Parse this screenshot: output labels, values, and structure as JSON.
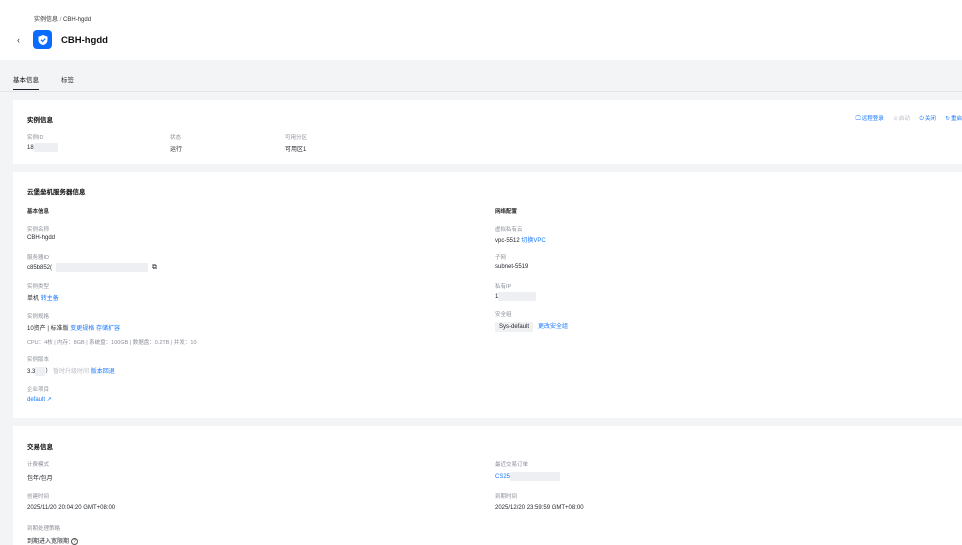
{
  "breadcrumb": {
    "parent": "实例信息",
    "separator": "/",
    "current": "CBH-hgdd"
  },
  "header": {
    "back_icon": "chevron-left-icon",
    "logo_icon": "shield-icon",
    "title": "CBH-hgdd"
  },
  "tabs": [
    {
      "label": "基本信息",
      "active": true
    },
    {
      "label": "标签",
      "active": false
    }
  ],
  "instance_card": {
    "title": "实例信息",
    "actions": [
      {
        "icon": "monitor-icon",
        "label": "远程登录",
        "enabled": true
      },
      {
        "icon": "play-icon",
        "label": "启动",
        "enabled": false
      },
      {
        "icon": "power-icon",
        "label": "关闭",
        "enabled": true
      },
      {
        "icon": "restart-icon",
        "label": "重启",
        "enabled": true
      }
    ],
    "fields": [
      {
        "label": "实例ID",
        "value": "18"
      },
      {
        "label": "状态",
        "value": "运行"
      },
      {
        "label": "可用分区",
        "value": "可用区1"
      }
    ]
  },
  "server_card": {
    "title": "云堡垒机服务器信息",
    "basic": {
      "title": "基本信息",
      "name": {
        "label": "实例名称",
        "value": "CBH-hgdd"
      },
      "server_id": {
        "label": "服务器ID",
        "value": "c85b852("
      },
      "type": {
        "label": "实例类型",
        "value": "单机",
        "link": "转主备"
      },
      "spec": {
        "label": "实例规格",
        "value": "10资产 | 标准版",
        "links": [
          "变更规格",
          "存储扩容"
        ],
        "detail": "CPU：4核 | 内存：8GB | 系统盘：100GB | 数据盘：0.2TB | 并发：10"
      },
      "version": {
        "label": "实例版本",
        "value_prefix": "3.3",
        "value_suffix": "）",
        "hint": "暂时升级时间",
        "link": "版本回退"
      },
      "project": {
        "label": "企业项目",
        "value": "default"
      }
    },
    "network": {
      "title": "网络配置",
      "vpc": {
        "label": "虚拟私有云",
        "value": "vpc-5512",
        "link": "切换VPC"
      },
      "subnet": {
        "label": "子网",
        "value": "subnet-5519"
      },
      "private_ip": {
        "label": "私有IP",
        "value": "1"
      },
      "security_group": {
        "label": "安全组",
        "value": "Sys-default",
        "link": "更改安全组"
      }
    }
  },
  "trade_card": {
    "title": "交易信息",
    "billing": {
      "label": "计费模式",
      "value": "包年/包月"
    },
    "created": {
      "label": "创建时间",
      "value": "2025/11/20 20:04:20 GMT+08:00"
    },
    "expiry_policy": {
      "label": "到期处理策略",
      "value": "到期进入宽限期"
    },
    "order": {
      "label": "最近交易订单",
      "value": "CS25"
    },
    "expires": {
      "label": "到期时间",
      "value": "2025/12/20 23:59:59 GMT+08:00"
    }
  }
}
